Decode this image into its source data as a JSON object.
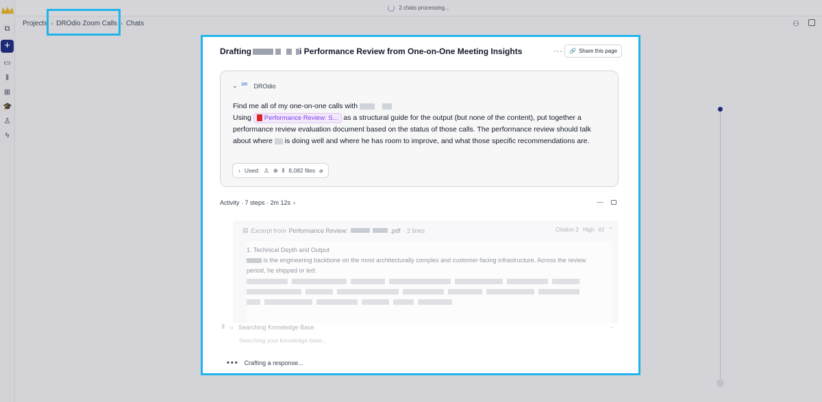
{
  "status": {
    "text": "2 chats processing..."
  },
  "breadcrumb": {
    "items": [
      "Projects",
      "DROdio Zoom Calls",
      "Chats"
    ]
  },
  "header": {
    "title_prefix": "Drafting",
    "title_suffix": "i Performance Review from One-on-One Meeting Insights",
    "more_label": "···",
    "share_label": "Share this page"
  },
  "message": {
    "avatar_initials": "DR",
    "user": "DROdio",
    "line1": "Find me all of my one-on-one calls with",
    "using": "Using",
    "chip_label": "Performance Review: S...",
    "rest1": " as a structural guide for the output (but none of the content), put together a performance review evaluation document based on the status of those calls. The performance review should talk about where ",
    "rest2": " is doing well and where he has room to improve, and what those specific recommendations are.",
    "used_label": "Used:",
    "files_label": "8,082 files"
  },
  "activity": {
    "label": "Activity · 7 steps · 2m 12s"
  },
  "excerpt": {
    "prefix": "Excerpt from",
    "doc": "Performance Review:",
    "ext": ".pdf",
    "lines": "· 2 lines",
    "citation": "Citation 2",
    "confidence": "High",
    "number": "#2",
    "heading": "1. Technical Depth and Output",
    "body1": " is the engineering backbone on the most architecturally complex and customer-facing infrastructure. Across the review",
    "body2": "period, he shipped or led:"
  },
  "search": {
    "label": "Searching Knowledge Base",
    "sub": "Searching your knowledge base..."
  },
  "crafting": {
    "label": "Crafting a response..."
  },
  "colors": {
    "accent": "#1e2a78",
    "highlight": "#1fb3ec",
    "chip": "#7c3aed"
  }
}
